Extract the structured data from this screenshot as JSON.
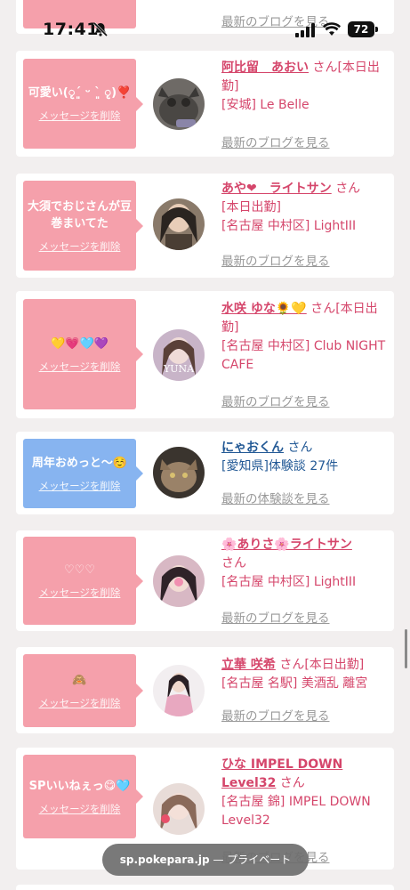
{
  "status_bar": {
    "time": "17:41",
    "battery": "72"
  },
  "top_partial": {
    "blog_link": "最新のブログを見る"
  },
  "cards": [
    {
      "bubble_color": "pink",
      "message": "可愛い(ृ´͈ ᵕ `͈ ृ)❣️",
      "delete_label": "メッセージを削除",
      "name": "阿比留　あおい",
      "san": "さん",
      "status": "[本日出勤]",
      "shop": "[安城] Le Belle",
      "link": "最新のブログを見る"
    },
    {
      "bubble_color": "pink",
      "message": "大須でおじさんが豆巻まいてた",
      "delete_label": "メッセージを削除",
      "name": "あや❤︎　ライトサン",
      "san": "さん",
      "status": "[本日出勤]",
      "shop": "[名古屋 中村区] LightIII",
      "link": "最新のブログを見る"
    },
    {
      "bubble_color": "pink",
      "message": "💛💗🩵💜",
      "delete_label": "メッセージを削除",
      "name": "水咲 ゆな🌻💛",
      "san": "さん",
      "status": "[本日出勤]",
      "shop": "[名古屋 中村区] Club NIGHT CAFE",
      "link": "最新のブログを見る"
    },
    {
      "bubble_color": "blue",
      "message": "周年おめっと〜☺️",
      "delete_label": "メッセージを削除",
      "name": "にゃおくん",
      "san": "さん",
      "status": "",
      "shop": "[愛知県]体験談 27件",
      "link": "最新の体験談を見る"
    },
    {
      "bubble_color": "pink",
      "message": "♡♡♡",
      "delete_label": "メッセージを削除",
      "name": "🌸ありさ🌸ライトサン",
      "san": "さん",
      "status": "",
      "shop": "[名古屋 中村区] LightIII",
      "link": "最新のブログを見る"
    },
    {
      "bubble_color": "pink",
      "message": "🙈",
      "delete_label": "メッセージを削除",
      "name": "立華 咲希",
      "san": "さん",
      "status": "[本日出勤]",
      "shop": "[名古屋 名駅] 美酒乱 離宮",
      "link": "最新のブログを見る"
    },
    {
      "bubble_color": "pink",
      "message": "SPいいねぇっ😋🩵",
      "delete_label": "メッセージを削除",
      "name": "ひな IMPEL DOWN Level32",
      "san": "さん",
      "status": "",
      "shop": "[名古屋 錦] IMPEL DOWN Level32",
      "link": "最新のブログを見る"
    }
  ],
  "url_bar": {
    "domain": "sp.pokepara.jp",
    "suffix": " — プライベート"
  },
  "colors": {
    "pink_bubble": "#f5a0ab",
    "blue_bubble": "#87b4f0",
    "name_pink": "#d5466b",
    "name_blue": "#245a96"
  }
}
